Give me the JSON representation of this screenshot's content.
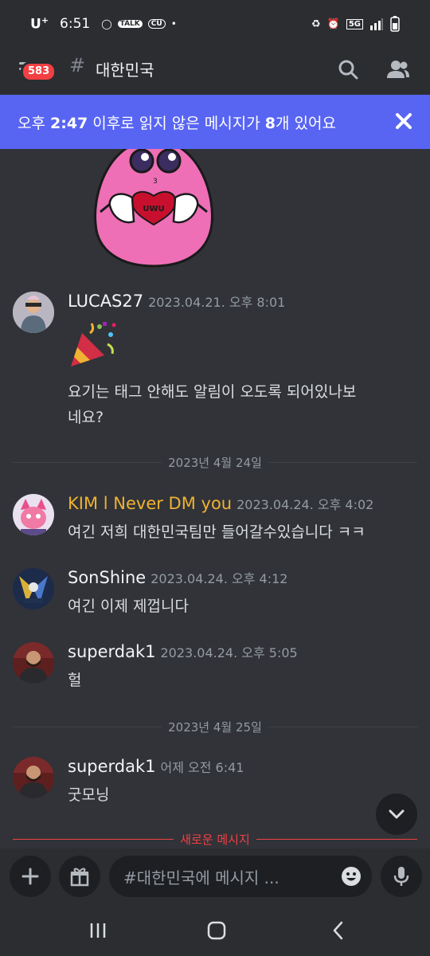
{
  "status_bar": {
    "carrier": "U",
    "carrier_sup": "+",
    "time": "6:51",
    "talk_label": "TALK",
    "cu_label": "CU",
    "network": "5G"
  },
  "header": {
    "badge_count": "583",
    "channel_name": "대한민국"
  },
  "banner": {
    "text_before": "오후 ",
    "time_bold": "2:47",
    "text_after": " 이후로 읽지 않은 메시지가 ",
    "count_bold": "8",
    "text_end": "개 있어요"
  },
  "sticker": {
    "label": "UWU"
  },
  "messages": [
    {
      "author": "LUCAS27",
      "timestamp": "2023.04.21. 오후 8:01",
      "line1": "요기는 태그 안해도 알림이 오도록 되어있나보",
      "line2": "네요?"
    },
    {
      "author": "KIM l Never DM you",
      "timestamp": "2023.04.24. 오후 4:02",
      "line1": "여긴 저희 대한민국팀만 들어갈수있습니다 ㅋㅋ"
    },
    {
      "author": "SonShine",
      "timestamp": "2023.04.24. 오후 4:12",
      "line1": "여긴 이제 제껍니다"
    },
    {
      "author": "superdak1",
      "timestamp": "2023.04.24. 오후 5:05",
      "line1": "헐"
    },
    {
      "author": "superdak1",
      "timestamp": "어제 오전 6:41",
      "line1": "굿모닝"
    }
  ],
  "dividers": {
    "date1": "2023년 4월 24일",
    "date2": "2023년 4월 25일",
    "new_messages": "새로운 메시지"
  },
  "composer": {
    "placeholder": "#대한민국에 메시지 ..."
  },
  "colors": {
    "accent": "#5865f2",
    "danger": "#f23f43",
    "gold_name": "#f0b232"
  }
}
